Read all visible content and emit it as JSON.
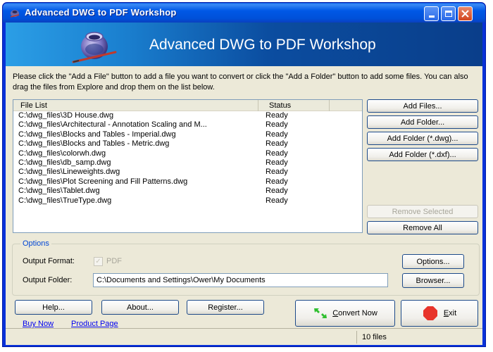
{
  "window": {
    "title": "Advanced DWG to PDF Workshop",
    "controls": [
      "minimize",
      "maximize",
      "close"
    ]
  },
  "banner": {
    "title": "Advanced DWG to PDF Workshop",
    "logo_icon": "ink-pot-pen-icon"
  },
  "instructions": "Please click the \"Add a File\" button to add a file you want to convert or click the \"Add a Folder\" button to add some files. You can also drag the files from Explore and drop them on the list below.",
  "file_list": {
    "columns": [
      "File List",
      "Status"
    ],
    "rows": [
      {
        "file": "C:\\dwg_files\\3D House.dwg",
        "status": "Ready"
      },
      {
        "file": "C:\\dwg_files\\Architectural - Annotation Scaling and M...",
        "status": "Ready"
      },
      {
        "file": "C:\\dwg_files\\Blocks and Tables - Imperial.dwg",
        "status": "Ready"
      },
      {
        "file": "C:\\dwg_files\\Blocks and Tables - Metric.dwg",
        "status": "Ready"
      },
      {
        "file": "C:\\dwg_files\\colorwh.dwg",
        "status": "Ready"
      },
      {
        "file": "C:\\dwg_files\\db_samp.dwg",
        "status": "Ready"
      },
      {
        "file": "C:\\dwg_files\\Lineweights.dwg",
        "status": "Ready"
      },
      {
        "file": "C:\\dwg_files\\Plot Screening and Fill Patterns.dwg",
        "status": "Ready"
      },
      {
        "file": "C:\\dwg_files\\Tablet.dwg",
        "status": "Ready"
      },
      {
        "file": "C:\\dwg_files\\TrueType.dwg",
        "status": "Ready"
      }
    ]
  },
  "side_buttons": {
    "add_files": "Add Files...",
    "add_folder": "Add Folder...",
    "add_folder_dwg": "Add Folder (*.dwg)...",
    "add_folder_dxf": "Add Folder (*.dxf)...",
    "remove_selected": "Remove Selected",
    "remove_all": "Remove All"
  },
  "options": {
    "legend": "Options",
    "output_format_label": "Output Format:",
    "output_format_value": "PDF",
    "output_format_checked": true,
    "output_folder_label": "Output Folder:",
    "output_folder_value": "C:\\Documents and Settings\\Ower\\My Documents",
    "options_button": "Options...",
    "browser_button": "Browser..."
  },
  "bottom": {
    "help": "Help...",
    "about": "About...",
    "register": "Register...",
    "buy_now": "Buy Now",
    "product_page": "Product Page",
    "convert_now_accel": "C",
    "convert_now_rest": "onvert Now",
    "exit_accel": "E",
    "exit_rest": "xit"
  },
  "status": {
    "file_count": "10 files"
  },
  "colors": {
    "title_blue": "#0058e6",
    "link_blue": "#0000ee",
    "legend_blue": "#0046d5",
    "exit_red": "#e8342b",
    "convert_green": "#2fbf2f"
  }
}
